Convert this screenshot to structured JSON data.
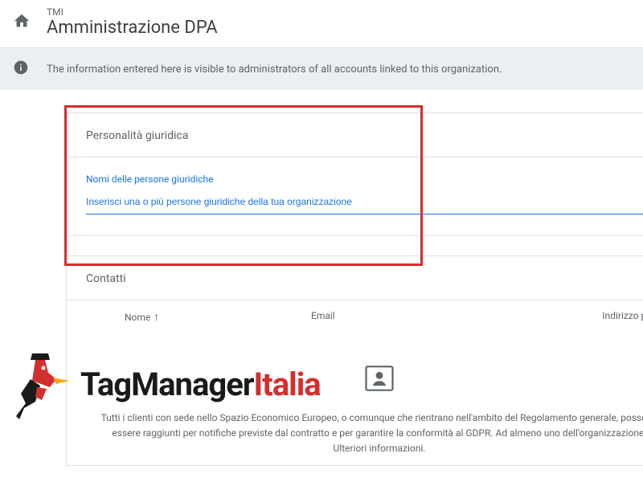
{
  "header": {
    "org_label": "TMI",
    "page_title": "Amministrazione DPA"
  },
  "info_bar": {
    "text": "The information entered here is visible to administrators of all accounts linked to this organization."
  },
  "legal_entity": {
    "title": "Personalità giuridica",
    "field_label": "Nomi delle persone giuridiche",
    "field_placeholder": "Inserisci una o più persone giuridiche della tua organizzazione"
  },
  "contacts": {
    "title": "Contatti",
    "columns": {
      "name": "Nome",
      "email": "Email",
      "address": "Indirizzo postale"
    },
    "sort_arrow": "↑",
    "empty_text": "Tutti i clienti con sede nello Spazio Economico Europeo, o comunque che rientrano nell'ambito del Regolamento generale, possono essere raggiunti per notifiche previste dal contratto e per garantire la conformità al GDPR. Ad almeno uno dell'organizzazione. Ulteriori informazioni."
  },
  "watermark": {
    "part1": "TagManager",
    "part2": "Italia"
  }
}
